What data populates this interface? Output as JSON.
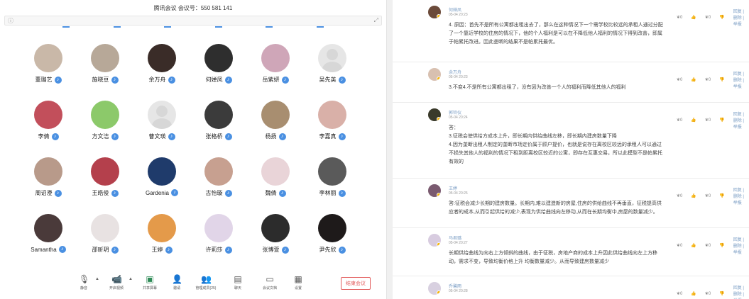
{
  "meeting": {
    "title": "腾讯会议 会议号：550 581 141",
    "participants": [
      {
        "name": "董璐艺",
        "avatar_color": "#c9b8a8"
      },
      {
        "name": "施晓豆",
        "avatar_color": "#b7a898"
      },
      {
        "name": "余万舟",
        "avatar_color": "#3a2c28"
      },
      {
        "name": "何婵凤",
        "avatar_color": "#2e2e2e"
      },
      {
        "name": "岳紫妍",
        "avatar_color": "#cfa6b8"
      },
      {
        "name": "吴先英",
        "avatar_color": "#e6e6e6",
        "placeholder": true
      },
      {
        "name": "李倩",
        "avatar_color": "#c24f5b"
      },
      {
        "name": "方文洁",
        "avatar_color": "#8cc96a"
      },
      {
        "name": "曹文瑛",
        "avatar_color": "#e6e6e6",
        "placeholder": true
      },
      {
        "name": "张格桥",
        "avatar_color": "#3b3b3b"
      },
      {
        "name": "杨扬",
        "avatar_color": "#a88e70"
      },
      {
        "name": "李嘉真",
        "avatar_color": "#d9b0a8"
      },
      {
        "name": "周诏澄",
        "avatar_color": "#b89a8a"
      },
      {
        "name": "王皓俊",
        "avatar_color": "#b4404c"
      },
      {
        "name": "Gardenia",
        "avatar_color": "#1f3b6b"
      },
      {
        "name": "古怡璇",
        "avatar_color": "#c7a090"
      },
      {
        "name": "魏倩",
        "avatar_color": "#e9d4d8"
      },
      {
        "name": "李林丽",
        "avatar_color": "#5a5a5a"
      },
      {
        "name": "Samantha",
        "avatar_color": "#4a3a3a"
      },
      {
        "name": "邵昕玥",
        "avatar_color": "#e8e2e2"
      },
      {
        "name": "王婷",
        "avatar_color": "#e49a4a"
      },
      {
        "name": "许莉莎",
        "avatar_color": "#e1d5e8"
      },
      {
        "name": "张博萱",
        "avatar_color": "#2c2c2c"
      },
      {
        "name": "尹先欣",
        "avatar_color": "#1e1a1a"
      }
    ],
    "toolbar": [
      {
        "label": "静音",
        "icon": "microphone-icon"
      },
      {
        "label": "开启视频",
        "icon": "video-camera-icon"
      },
      {
        "label": "共享屏幕",
        "icon": "screen-share-icon"
      },
      {
        "label": "邀请",
        "icon": "invite-icon"
      },
      {
        "label": "管理成员(25)",
        "icon": "members-icon"
      },
      {
        "label": "聊天",
        "icon": "chat-icon"
      },
      {
        "label": "会议文档",
        "icon": "document-icon"
      },
      {
        "label": "设置",
        "icon": "settings-icon"
      }
    ],
    "end_button": "结束会议",
    "accent_color": "#4a90e2"
  },
  "comments": [
    {
      "name": "何婵凤",
      "date": "05-04 20:23",
      "avatar_color": "#6b4a3a",
      "lines": [
        "4. 原因：首先不是所有公寓都出租出去了，那么在这种情况下一个需学校比较远的承租人通过分配",
        "了一个靠近学校的住房的情况下，他的个人福利是可以在不降低他人福利的情况下得到改善，即属",
        "于帕累托改进。因此垄断的结果不是帕累托最优。"
      ]
    },
    {
      "name": "余万舟",
      "date": "05-04 20:23",
      "avatar_color": "#d8c0b0",
      "lines": [
        "3.不变4.不是所有公寓都出租了，没有因为改善一个人的福利而降低其他人的福利"
      ]
    },
    {
      "name": "郭铃仪",
      "date": "05-04 20:24",
      "avatar_color": "#3a3a2a",
      "lines": [
        "答：",
        "3.征税会使供给方成本上升，即长期内供给曲线左移，即长期内建房数量下降",
        "4.因为垄断出租人制定的垄断市场定价属于顾户提价，也就是说存在离校区较远的承租人可以通过",
        "不损失其他人的福利的情况下租到距离校区较近的公寓，即存在互惠交易，所以此模型不是帕累托",
        "有效的"
      ]
    },
    {
      "name": "王婷",
      "date": "05-04 20:25",
      "avatar_color": "#7a5a70",
      "lines": [
        "答:征税会减少长期的建房数量。长期内,难以建造新的房屋,住房的供给曲线不再垂直，征税提高供",
        "应者的成本,从而引起供给的减少,表现为供给曲线向左移动,从而在长期均衡中,房屋的数量减少。"
      ]
    },
    {
      "name": "马君璐",
      "date": "05-04 20:27",
      "avatar_color": "#d8cce0",
      "lines": [
        "长期供给曲线为向右上方倾斜的曲线，由于征税，房地产商的成本上升因此供给曲线向左上方移",
        "动，需求不变，导致均衡价格上升 均衡数量减少。从而导致建房数量减少"
      ]
    },
    {
      "name": "乔馨雨",
      "date": "05-04 20:28",
      "avatar_color": "#d8d0e0",
      "lines": []
    }
  ],
  "comment_actions": {
    "up_count": "0",
    "down_count": "0",
    "links": "回复 | 删除 | 举报"
  }
}
